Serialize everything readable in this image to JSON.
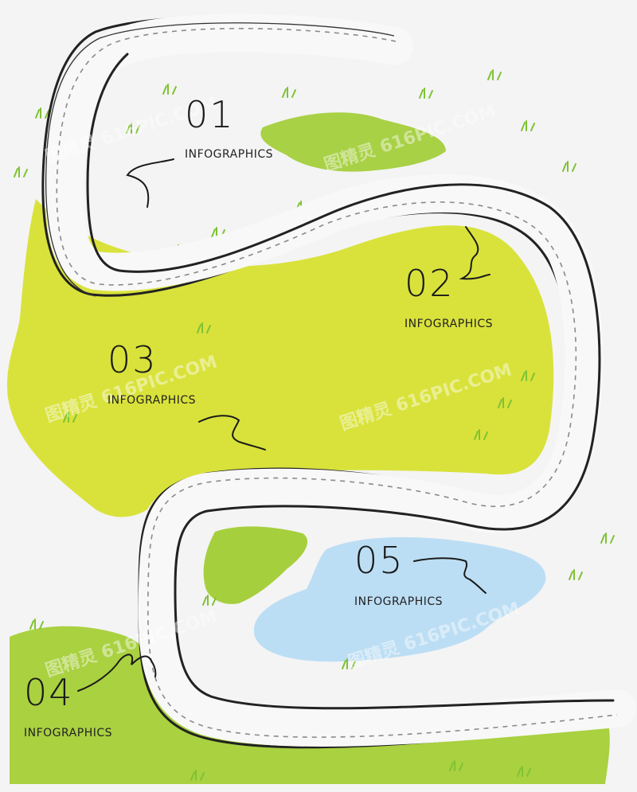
{
  "steps": [
    {
      "number": "01",
      "label": "INFOGRAPHICS"
    },
    {
      "number": "02",
      "label": "INFOGRAPHICS"
    },
    {
      "number": "03",
      "label": "INFOGRAPHICS"
    },
    {
      "number": "04",
      "label": "INFOGRAPHICS"
    },
    {
      "number": "05",
      "label": "INFOGRAPHICS"
    }
  ],
  "watermark": "图精灵 616PIC.COM",
  "colors": {
    "background": "#f4f4f4",
    "grass_yellow_green": "#d8e23a",
    "grass_green": "#a6d040",
    "pond_blue": "#b9ddf3",
    "road_fill": "#f7f7f7",
    "road_edge": "#222222",
    "road_dash": "#888888"
  }
}
